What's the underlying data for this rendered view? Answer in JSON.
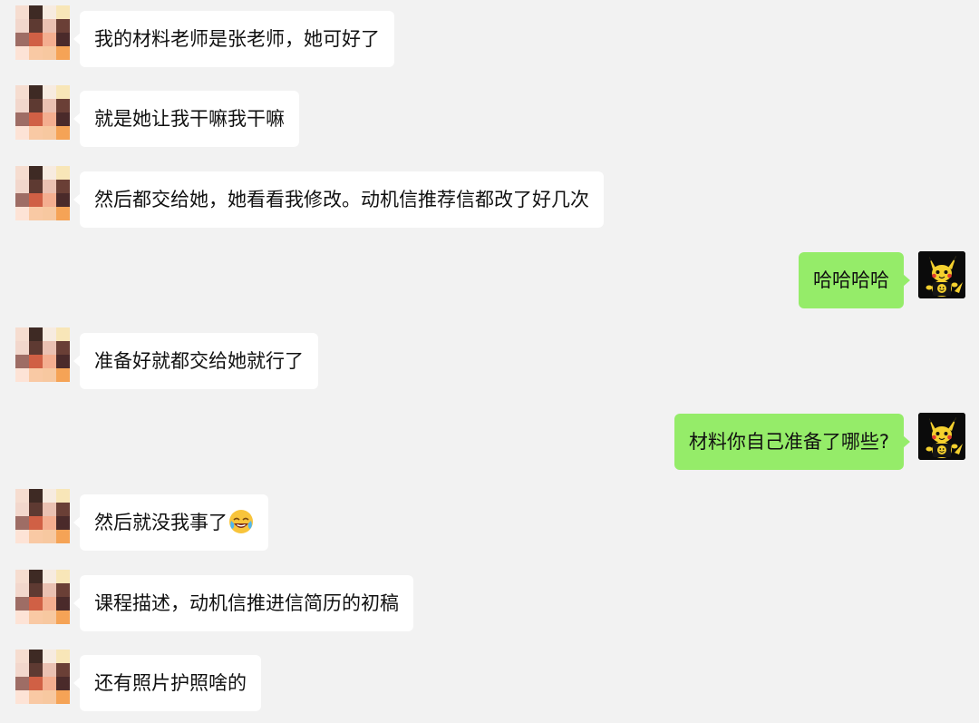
{
  "messages": [
    {
      "side": "left",
      "text": "我的材料老师是张老师，她可好了"
    },
    {
      "side": "left",
      "text": "就是她让我干嘛我干嘛"
    },
    {
      "side": "left",
      "text": "然后都交给她，她看看我修改。动机信推荐信都改了好几次"
    },
    {
      "side": "right",
      "text": "哈哈哈哈"
    },
    {
      "side": "left",
      "text": "准备好就都交给她就行了"
    },
    {
      "side": "right",
      "text": "材料你自己准备了哪些?"
    },
    {
      "side": "left",
      "text": "然后就没我事了",
      "emoji": "rolling-laughing-emoji"
    },
    {
      "side": "left",
      "text": "课程描述，动机信推进信简历的初稿"
    },
    {
      "side": "left",
      "text": "还有照片护照啥的"
    }
  ],
  "colors": {
    "background": "#f2f2f2",
    "incoming_bubble": "#ffffff",
    "outgoing_bubble": "#95ec69",
    "text": "#111111"
  },
  "icons": {
    "left_avatar": "pixelated-avatar",
    "right_avatar": "pikachu-avatar",
    "emoji": "rolling-laughing-emoji"
  }
}
